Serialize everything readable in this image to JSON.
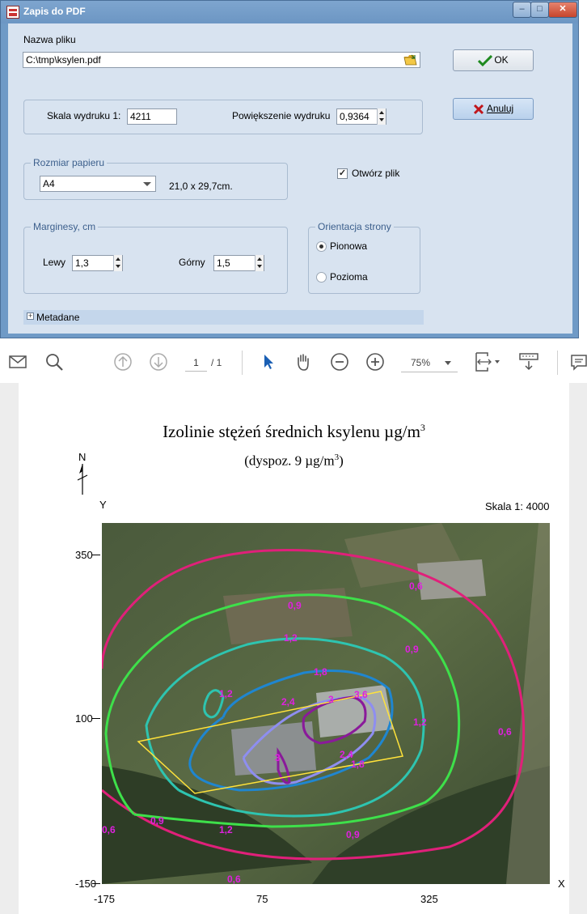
{
  "dialog": {
    "title": "Zapis do PDF",
    "file_label": "Nazwa pliku",
    "file_value": "C:\\tmp\\ksylen.pdf",
    "scale_label": "Skala wydruku 1:",
    "scale_value": "4211",
    "zoom_label": "Powiększenie wydruku",
    "zoom_value": "0,9364",
    "paper_group": "Rozmiar papieru",
    "paper_value": "A4",
    "paper_size": "21,0 x 29,7cm.",
    "open_file_label": "Otwórz plik",
    "open_file_checked": true,
    "margins_group": "Marginesy, cm",
    "left_label": "Lewy",
    "left_value": "1,3",
    "top_label": "Górny",
    "top_value": "1,5",
    "orientation_group": "Orientacja strony",
    "portrait_label": "Pionowa",
    "landscape_label": "Pozioma",
    "ok_label": "OK",
    "cancel_label": "Anuluj",
    "metadata_label": "Metadane",
    "metadata_expander": "+",
    "window_buttons": {
      "minimize": "–",
      "maximize": "□",
      "close": "✕"
    }
  },
  "viewer_toolbar": {
    "page_current": "1",
    "page_total": "/ 1",
    "zoom": "75%"
  },
  "document": {
    "title": "Izolinie stężeń średnich ksylenu µg/m",
    "title_sup": "3",
    "subtitle": "(dyspoz. 9 µg/m",
    "subtitle_sup": "3",
    "subtitle_end": ")",
    "north": "N",
    "scale_text": "Skala 1: 4000",
    "y_axis_label": "Y",
    "x_axis_label": "X",
    "y_ticks": [
      "350",
      "100",
      "-150"
    ],
    "x_ticks": [
      "-175",
      "75",
      "325"
    ],
    "contour_labels": [
      "0,6",
      "0,9",
      "1,2",
      "1,8",
      "2,4",
      "3",
      "3,6"
    ]
  },
  "colors": {
    "c06": "#e0207a",
    "c09": "#3ee04a",
    "c12": "#2ec4b0",
    "c18": "#1f86d0",
    "c24": "#8e8ef0",
    "c30": "#8a1a9a",
    "label": "#e020e0",
    "building": "#ffe23a"
  }
}
